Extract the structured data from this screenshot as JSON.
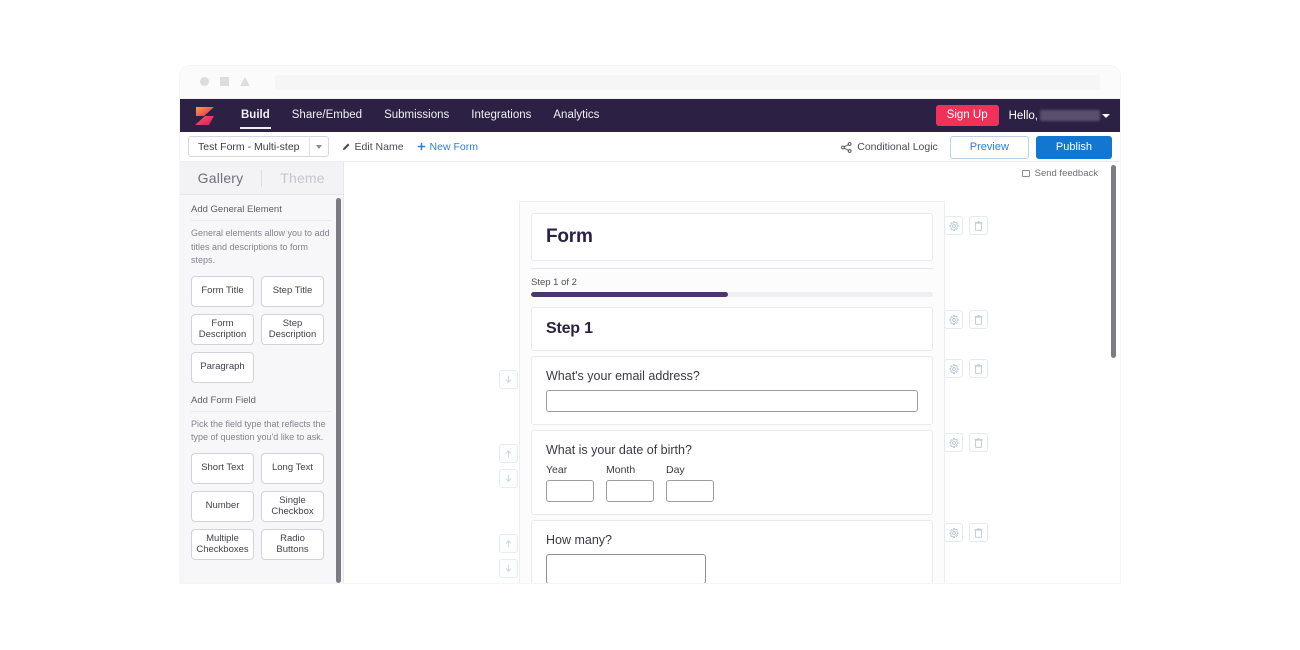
{
  "browser": {
    "chrome_icons": [
      "circle-icon",
      "square-icon",
      "triangle-icon"
    ]
  },
  "topnav": {
    "logo": "z-logo-icon",
    "links": [
      {
        "label": "Build",
        "active": true
      },
      {
        "label": "Share/Embed",
        "active": false
      },
      {
        "label": "Submissions",
        "active": false
      },
      {
        "label": "Integrations",
        "active": false
      },
      {
        "label": "Analytics",
        "active": false
      }
    ],
    "signup_label": "Sign Up",
    "hello_label": "Hello,",
    "user_name_redacted": "",
    "accent_signup": "#f0325a",
    "background": "#2c2144"
  },
  "subnav": {
    "form_select_value": "Test Form - Multi-step",
    "edit_name_label": "Edit Name",
    "new_form_label": "New Form",
    "conditional_logic_label": "Conditional Logic",
    "preview_label": "Preview",
    "publish_label": "Publish",
    "publish_color": "#1177d1",
    "link_color": "#2f7fd4"
  },
  "sidebar": {
    "tabs": [
      {
        "label": "Gallery",
        "active": true
      },
      {
        "label": "Theme",
        "active": false
      }
    ],
    "sections": [
      {
        "title": "Add General Element",
        "description": "General elements allow you to add titles and descriptions to form steps.",
        "chips": [
          "Form Title",
          "Step Title",
          "Form Description",
          "Step Description",
          "Paragraph"
        ]
      },
      {
        "title": "Add Form Field",
        "description": "Pick the field type that reflects the type of question you'd like to ask.",
        "chips": [
          "Short Text",
          "Long Text",
          "Number",
          "Single Checkbox",
          "Multiple Checkboxes",
          "Radio Buttons"
        ]
      }
    ]
  },
  "canvas": {
    "send_feedback_label": "Send feedback",
    "form_title": "Form",
    "step_counter": "Step 1 of 2",
    "progress_percent": 49,
    "progress_color": "#4d356e",
    "step_title": "Step 1",
    "questions": [
      {
        "label": "What's your email address?",
        "type": "short-text"
      },
      {
        "label": "What is your date of birth?",
        "type": "date",
        "subfields": [
          "Year",
          "Month",
          "Day"
        ]
      },
      {
        "label": "How many?",
        "type": "number"
      }
    ],
    "row_icons": {
      "settings": "gear-icon",
      "delete": "trash-icon",
      "move_up": "arrow-up-icon",
      "move_down": "arrow-down-icon"
    }
  }
}
